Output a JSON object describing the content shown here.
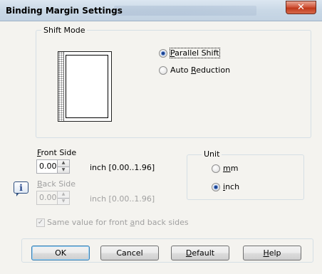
{
  "window": {
    "title": "Binding Margin Settings",
    "close_symbol": "✕"
  },
  "shift_mode": {
    "legend": "Shift Mode",
    "options": [
      {
        "label_pre": "",
        "mnemonic": "P",
        "label_post": "arallel Shift",
        "selected": true
      },
      {
        "label_pre": "Auto ",
        "mnemonic": "R",
        "label_post": "eduction",
        "selected": false
      }
    ]
  },
  "front_side": {
    "label_mnemonic": "F",
    "label_rest": "ront Side",
    "value": "0.00",
    "range": "inch [0.00..1.96]"
  },
  "back_side": {
    "label_mnemonic": "B",
    "label_rest": "ack Side",
    "value": "0.00",
    "range": "inch [0.00..1.96]",
    "enabled": false
  },
  "unit": {
    "legend": "Unit",
    "options": [
      {
        "mnemonic": "m",
        "label_post": "m",
        "selected": false
      },
      {
        "mnemonic": "i",
        "label_post": "nch",
        "selected": true
      }
    ]
  },
  "same_value": {
    "label_pre": "Same value for front ",
    "mnemonic": "a",
    "label_post": "nd back sides",
    "checked": true,
    "enabled": false
  },
  "info_icon_glyph": "i",
  "buttons": {
    "ok": "OK",
    "cancel": "Cancel",
    "default_mnemonic": "D",
    "default_rest": "efault",
    "help_mnemonic": "H",
    "help_rest": "elp"
  },
  "colors": {
    "accent": "#1a3f8a",
    "close_button": "#c0391b"
  }
}
